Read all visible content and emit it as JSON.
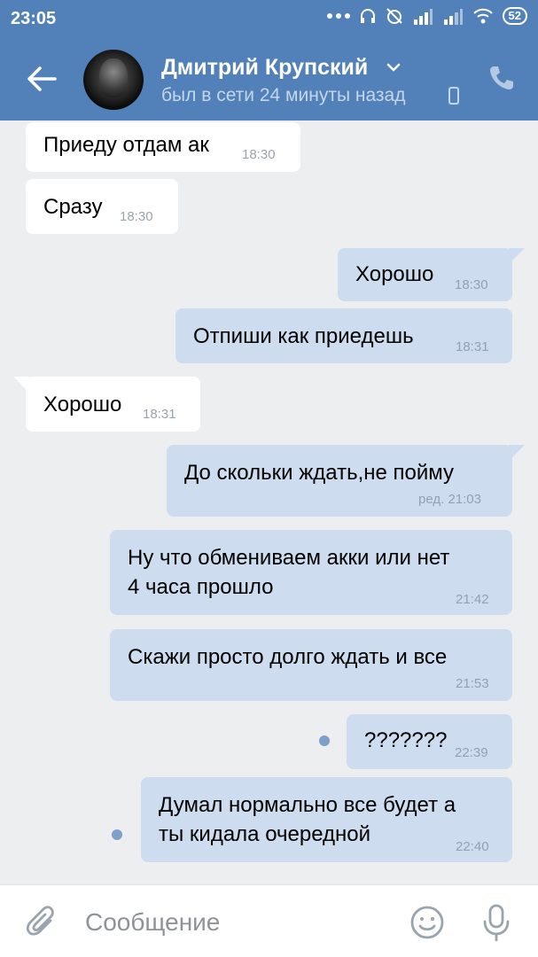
{
  "status_bar": {
    "time": "23:05",
    "battery": "52",
    "icons": [
      "more-dots-icon",
      "headphones-icon",
      "alarm-off-icon",
      "signal-icon",
      "signal-icon",
      "wifi-icon",
      "battery-icon"
    ]
  },
  "header": {
    "name": "Дмитрий Крупский",
    "status": "был в сети 24 минуты назад",
    "colors": {
      "bar": "#5181b8",
      "status_text": "#c5d6ea"
    }
  },
  "messages": [
    {
      "direction": "in",
      "lines": [
        "Приеду отдам ак"
      ],
      "time": "18:30"
    },
    {
      "direction": "in",
      "lines": [
        "Сразу"
      ],
      "time": "18:30"
    },
    {
      "direction": "out",
      "lines": [
        "Хорошо"
      ],
      "time": "18:30"
    },
    {
      "direction": "out",
      "lines": [
        "Отпиши как приедешь"
      ],
      "time": "18:31"
    },
    {
      "direction": "in",
      "lines": [
        "Хорошо"
      ],
      "time": "18:31"
    },
    {
      "direction": "out",
      "lines": [
        "До скольки ждать,не пойму"
      ],
      "time": "ред. 21:03"
    },
    {
      "direction": "out",
      "lines": [
        "Ну что обмениваем акки или нет",
        "4 часа прошло"
      ],
      "time": "21:42"
    },
    {
      "direction": "out",
      "lines": [
        "Скажи просто долго ждать и все"
      ],
      "time": "21:53"
    },
    {
      "direction": "out",
      "lines": [
        "???????"
      ],
      "time": "22:39",
      "unread": true
    },
    {
      "direction": "out",
      "lines": [
        "Думал нормально все будет а",
        "ты кидала очередной"
      ],
      "time": "22:40",
      "unread": true
    }
  ],
  "composer": {
    "placeholder": "Сообщение"
  },
  "colors": {
    "background": "#edeef0",
    "incoming_bubble": "#ffffff",
    "outgoing_bubble": "#cddcee",
    "unread_dot": "#7f9fcb"
  }
}
